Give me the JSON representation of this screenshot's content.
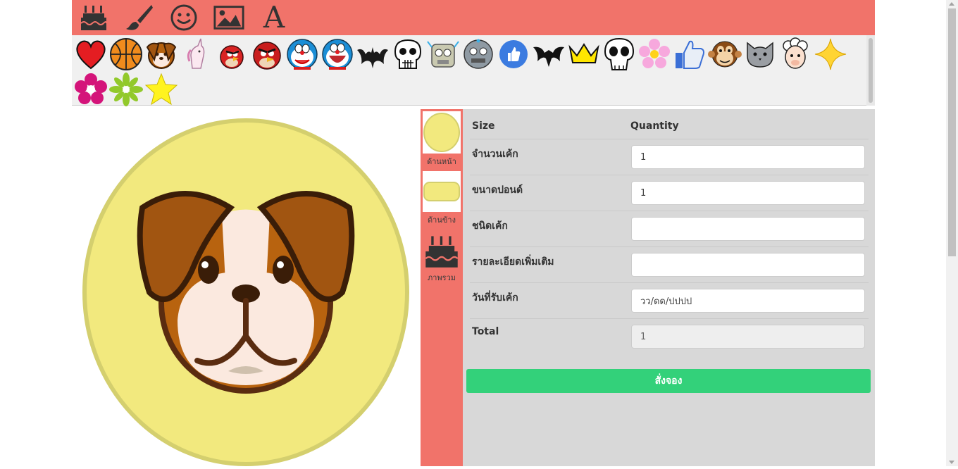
{
  "toolbar": {
    "tools": [
      "cake-tool-icon",
      "brush-icon",
      "smiley-icon",
      "image-icon",
      "text-icon"
    ],
    "text_tool_glyph": "A",
    "bg_color": "#f1736a"
  },
  "stickers": [
    "heart-icon",
    "basketball-icon",
    "dog-face-icon",
    "unicorn-icon",
    "angry-bird-red-icon",
    "angry-bird-large-icon",
    "doraemon-icon",
    "doraemon-laugh-icon",
    "bat-icon",
    "skull-cartoon-icon",
    "robot-blue-icon",
    "robot-grey-icon",
    "facebook-like-icon",
    "bat-black-icon",
    "crown-icon",
    "skull-icon",
    "pink-flower-icon",
    "thumbs-up-icon",
    "monkey-icon",
    "cat-icon",
    "sheep-icon",
    "sparkle-star-icon",
    "magenta-flower-icon",
    "green-flower-icon",
    "yellow-star-icon"
  ],
  "views": {
    "front_label": "ด้านหน้า",
    "side_label": "ด้านข้าง",
    "overview_label": "ภาพรวม"
  },
  "form": {
    "header_size": "Size",
    "header_quantity": "Quantity",
    "rows": [
      {
        "label": "จำนวนเค้ก",
        "value": "1"
      },
      {
        "label": "ขนาดปอนด์",
        "value": "1"
      },
      {
        "label": "ชนิดเค้ก",
        "value": ""
      },
      {
        "label": "รายละเอียดเพิ่มเติม",
        "value": ""
      },
      {
        "label": "วันที่รับเค้ก",
        "value": "วว/ดด/ปปปป"
      },
      {
        "label": "Total",
        "value": "1"
      }
    ],
    "submit_label": "สั่งจอง"
  },
  "colors": {
    "accent": "#f1736a",
    "cake_fill": "#f2e97e",
    "submit": "#33d17a"
  }
}
